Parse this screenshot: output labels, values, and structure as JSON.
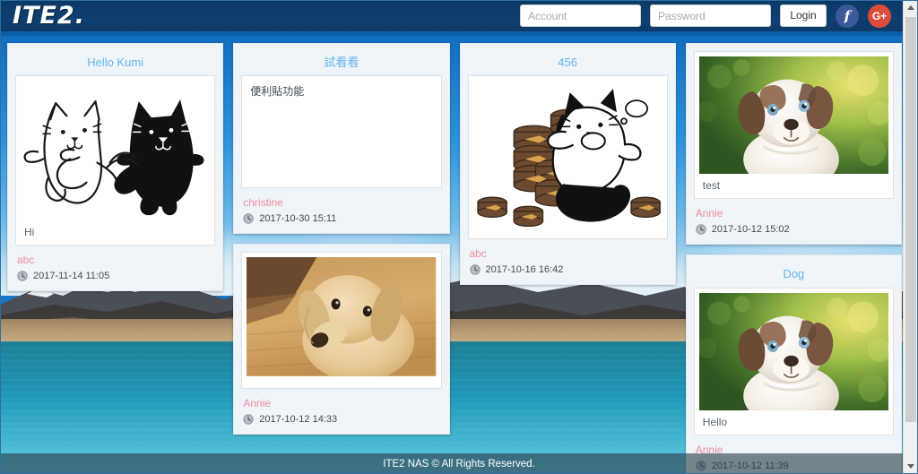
{
  "header": {
    "logo": "ITE2.",
    "account_placeholder": "Account",
    "password_placeholder": "Password",
    "account_value": "",
    "password_value": "",
    "login_label": "Login",
    "facebook_icon": "facebook-icon",
    "facebook_glyph": "f",
    "google_icon": "google-plus-icon",
    "google_glyph": "G+",
    "bg_color": "#0e3f70",
    "accent_color": "#0a5fa8"
  },
  "colors": {
    "card_bg": "#eff4f8",
    "card_title": "#64b5ef",
    "author": "#ef8ca0",
    "timestamp": "#4a4a4a",
    "footer_text": "#ffffff"
  },
  "cards": [
    {
      "id": "card-hello-kumi",
      "title": "Hello Kumi",
      "kind": "illustration-two-cats",
      "caption": "Hi",
      "author": "abc",
      "timestamp": "2017-11-14 11:05",
      "clock_icon": "clock-icon"
    },
    {
      "id": "card-shikankan",
      "title": "試看看",
      "kind": "note",
      "note_text": "便利貼功能",
      "caption": "",
      "author": "christine",
      "timestamp": "2017-10-30 15:11",
      "clock_icon": "clock-icon"
    },
    {
      "id": "card-456",
      "title": "456",
      "kind": "illustration-cat-cans",
      "caption": "",
      "author": "abc",
      "timestamp": "2017-10-16 16:42",
      "clock_icon": "clock-icon"
    },
    {
      "id": "card-test",
      "title": "",
      "kind": "photo-puppy",
      "caption": "test",
      "author": "Annie",
      "timestamp": "2017-10-12 15:02",
      "clock_icon": "clock-icon"
    },
    {
      "id": "card-golden",
      "title": "",
      "kind": "photo-golden",
      "caption": "",
      "author": "Annie",
      "timestamp": "2017-10-12 14:33",
      "clock_icon": "clock-icon"
    },
    {
      "id": "card-dog",
      "title": "Dog",
      "kind": "photo-puppy",
      "caption": "Hello",
      "author": "Annie",
      "timestamp": "2017-10-12 11:39",
      "clock_icon": "clock-icon"
    }
  ],
  "footer": {
    "text": "ITE2 NAS © All Rights Reserved."
  },
  "scrollbar": {
    "up_icon": "scroll-up-arrow-icon",
    "down_icon": "scroll-down-arrow-icon"
  }
}
